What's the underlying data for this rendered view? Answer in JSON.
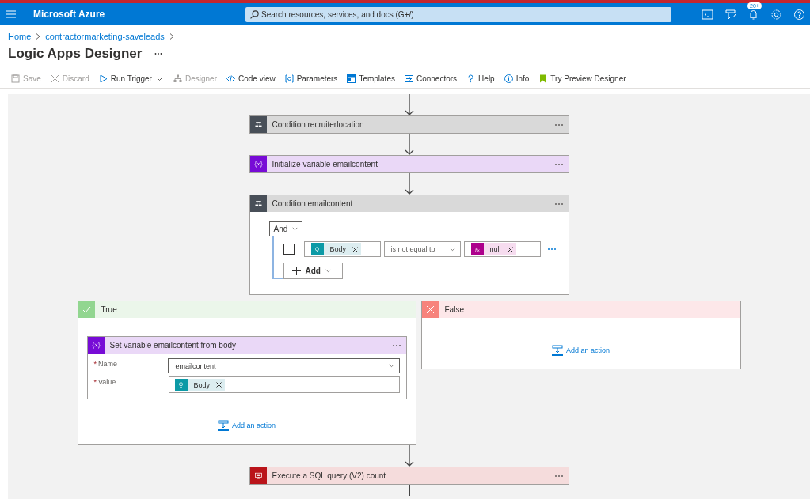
{
  "header": {
    "brand": "Microsoft Azure",
    "search": {
      "placeholder": "Search resources, services, and docs (G+/)"
    },
    "icons": [
      {
        "kind": "shell"
      },
      {
        "kind": "filter"
      },
      {
        "kind": "bell",
        "badge": "20+"
      },
      {
        "kind": "settings"
      },
      {
        "kind": "help"
      }
    ]
  },
  "breadcrumb": [
    "Home",
    "contractormarketing-saveleads"
  ],
  "page_title": "Logic Apps Designer",
  "toolbar": [
    {
      "kind": "save",
      "label": "Save",
      "disabled": true
    },
    {
      "kind": "discard",
      "label": "Discard",
      "disabled": true
    },
    {
      "kind": "run",
      "label": "Run Trigger",
      "disabled": false,
      "menu": true
    },
    {
      "kind": "designer",
      "label": "Designer",
      "disabled": true
    },
    {
      "kind": "code",
      "label": "Code view",
      "disabled": false
    },
    {
      "kind": "parameters",
      "label": "Parameters",
      "disabled": false
    },
    {
      "kind": "templates",
      "label": "Templates",
      "disabled": false
    },
    {
      "kind": "connectors",
      "label": "Connectors",
      "disabled": false
    },
    {
      "kind": "help",
      "label": "Help",
      "disabled": false
    },
    {
      "kind": "info",
      "label": "Info",
      "disabled": false
    },
    {
      "kind": "preview",
      "label": "Try Preview Designer",
      "disabled": false
    }
  ],
  "steps": [
    {
      "kind": "condition",
      "title": "Condition recruiterlocation",
      "expanded": false
    },
    {
      "kind": "variable",
      "title": "Initialize variable emailcontent"
    },
    {
      "kind": "condition",
      "title": "Condition emailcontent",
      "expanded": true,
      "group_operator": "And",
      "rows": [
        {
          "checked": false,
          "left": {
            "kind": "dynamic",
            "label": "Body"
          },
          "operator": "is not equal to",
          "right": {
            "kind": "expression",
            "label": "null"
          }
        }
      ],
      "add_label": "Add",
      "branches": [
        {
          "kind": "true",
          "label": "True",
          "actions": [
            {
              "kind": "variable",
              "title": "Set variable emailcontent from body",
              "fields": [
                {
                  "label": "Name",
                  "required_mark": "*",
                  "kind": "dropdown",
                  "value": "emailcontent"
                },
                {
                  "label": "Value",
                  "required_mark": "*",
                  "kind": "token",
                  "token": {
                    "kind": "dynamic",
                    "label": "Body"
                  }
                }
              ]
            }
          ],
          "add_action": "Add an action"
        },
        {
          "kind": "false",
          "label": "False",
          "add_action": "Add an action"
        }
      ]
    },
    {
      "kind": "sql",
      "title": "Execute a SQL query (V2) count"
    }
  ]
}
